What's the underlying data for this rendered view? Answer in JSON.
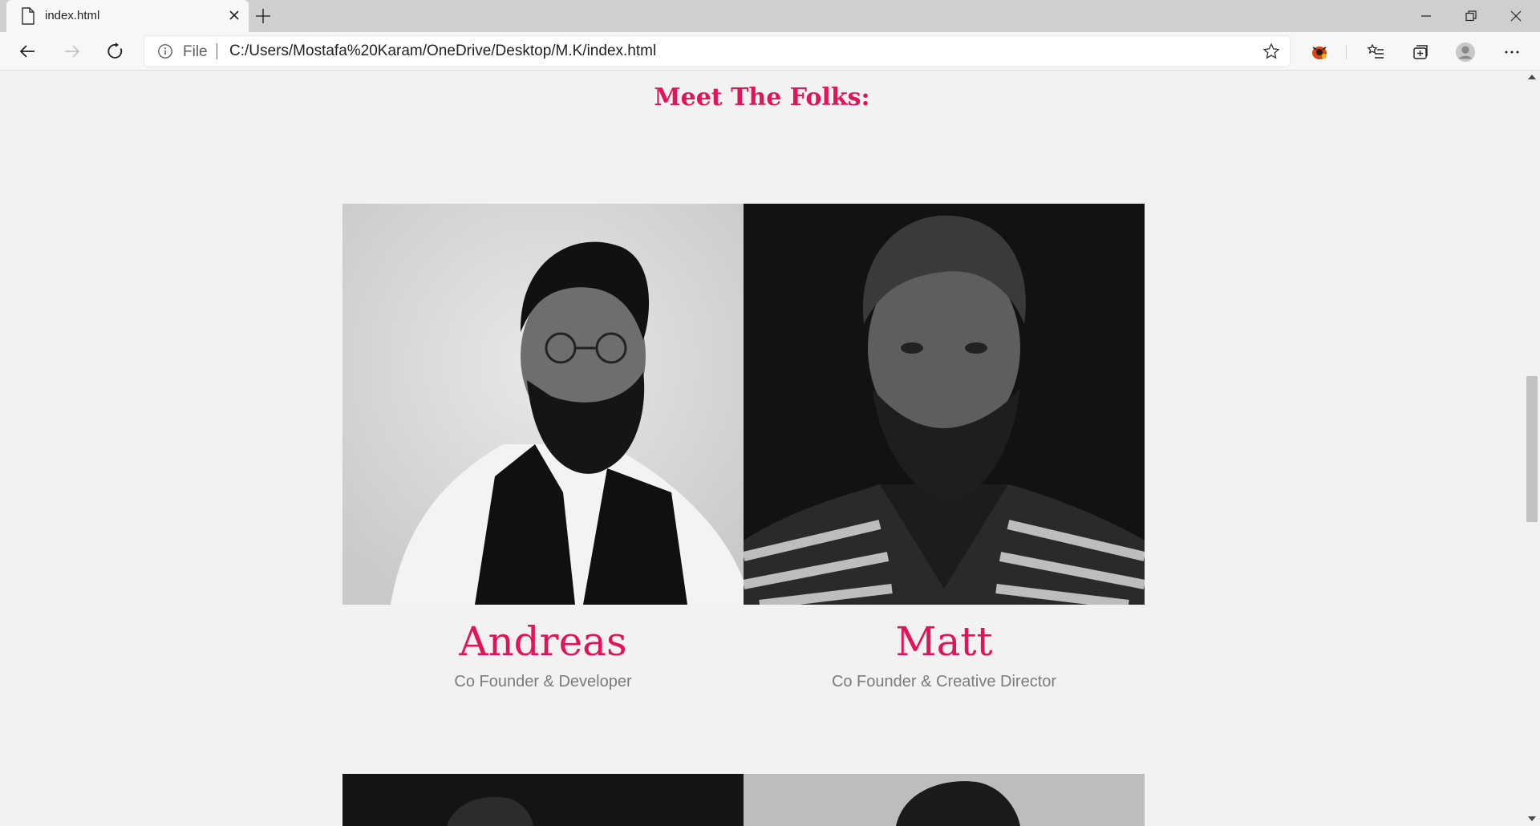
{
  "browser": {
    "tab": {
      "title": "index.html"
    },
    "address": {
      "scheme_label": "File",
      "url": "C:/Users/Mostafa%20Karam/OneDrive/Desktop/M.K/index.html"
    }
  },
  "page": {
    "section_heading": "Meet The Folks:",
    "team": [
      {
        "name": "Andreas",
        "role": "Co Founder & Developer"
      },
      {
        "name": "Matt",
        "role": "Co Founder & Creative Director"
      }
    ]
  },
  "colors": {
    "accent": "#e3135a",
    "role_text": "#7b7b7b",
    "page_bg": "#f2f2f2"
  },
  "icons": {
    "tab": "page-icon",
    "tab_close": "close-icon",
    "new_tab": "plus-icon",
    "back": "arrow-left-icon",
    "forward": "arrow-right-icon",
    "refresh": "refresh-icon",
    "info": "info-icon",
    "favorite": "star-icon",
    "extension": "extension-icon",
    "favorites": "favorites-list-icon",
    "collections": "collections-icon",
    "profile": "profile-avatar",
    "menu": "more-icon"
  }
}
